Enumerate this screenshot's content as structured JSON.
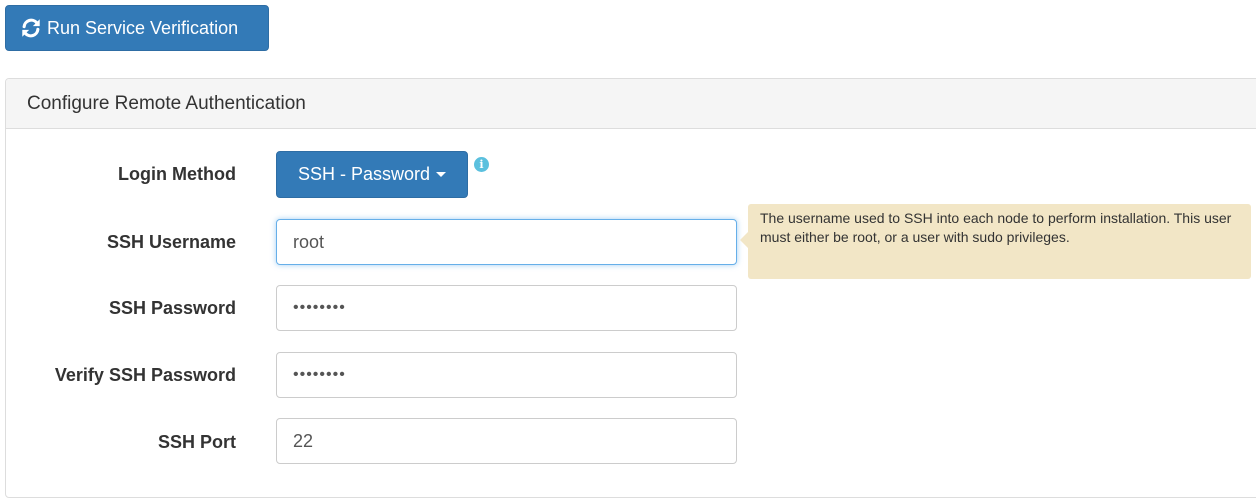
{
  "toolbar": {
    "run_verification_label": "Run Service Verification",
    "icon": "refresh-icon"
  },
  "panel": {
    "title": "Configure Remote Authentication"
  },
  "form": {
    "login_method": {
      "label": "Login Method",
      "selected": "SSH - Password",
      "info_icon": "info-circle-icon"
    },
    "ssh_username": {
      "label": "SSH Username",
      "value": "root",
      "help_text": "The username used to SSH into each node to perform installation. This user must either be root, or a user with sudo privileges."
    },
    "ssh_password": {
      "label": "SSH Password",
      "value": "••••••••"
    },
    "verify_ssh_password": {
      "label": "Verify SSH Password",
      "value": "••••••••"
    },
    "ssh_port": {
      "label": "SSH Port",
      "value": "22"
    }
  },
  "colors": {
    "primary": "#337ab7",
    "info": "#5bc0de",
    "tooltip_bg": "#f2e6c6",
    "focus_border": "#66afe9"
  }
}
